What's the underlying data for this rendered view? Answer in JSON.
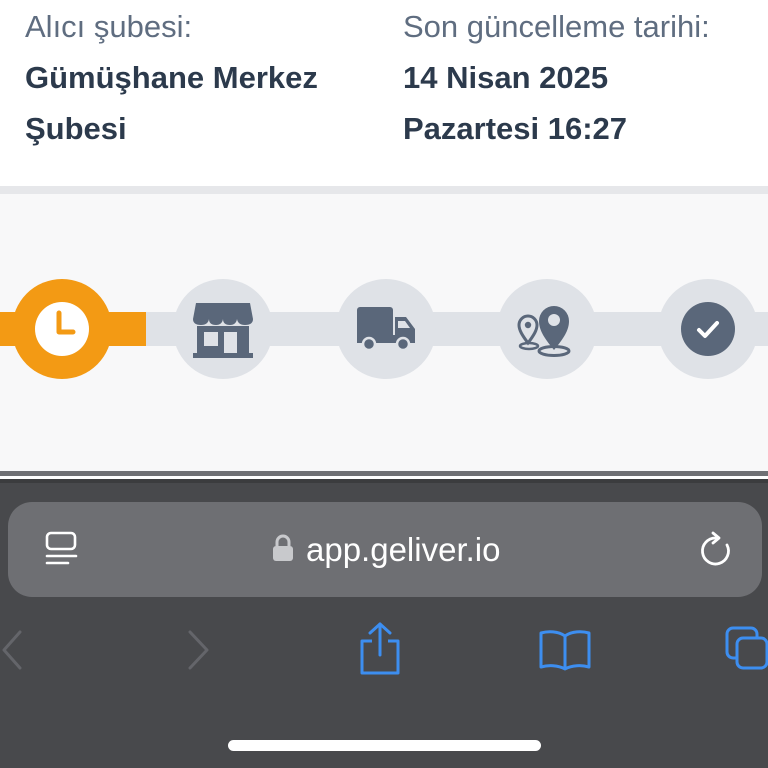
{
  "info": {
    "recipient_branch_label": "Alıcı şubesi:",
    "recipient_branch_line1": "Gümüşhane Merkez",
    "recipient_branch_line2": "Şubesi",
    "last_update_label": "Son güncelleme tarihi:",
    "last_update_line1": "14 Nisan 2025",
    "last_update_line2": "Pazartesi 16:27"
  },
  "tracking": {
    "progress_fraction": 0.19,
    "steps": [
      {
        "icon": "clock-icon",
        "active": true
      },
      {
        "icon": "store-icon",
        "active": false
      },
      {
        "icon": "truck-icon",
        "active": false
      },
      {
        "icon": "map-pin-icon",
        "active": false
      },
      {
        "icon": "check-circle-icon",
        "active": false
      }
    ]
  },
  "browser": {
    "url": "app.geliver.io",
    "icons": [
      "reader-icon",
      "lock-icon",
      "reload-icon",
      "back-icon",
      "forward-icon",
      "share-icon",
      "bookmarks-icon",
      "tabs-icon"
    ]
  },
  "colors": {
    "accent": "#f39a14",
    "step_bg": "#dfe2e7",
    "icon_dark": "#5a677a",
    "safari_blue": "#3d8ef0",
    "chrome_bg": "#48494c",
    "urlbar_bg": "#6e6f73"
  }
}
